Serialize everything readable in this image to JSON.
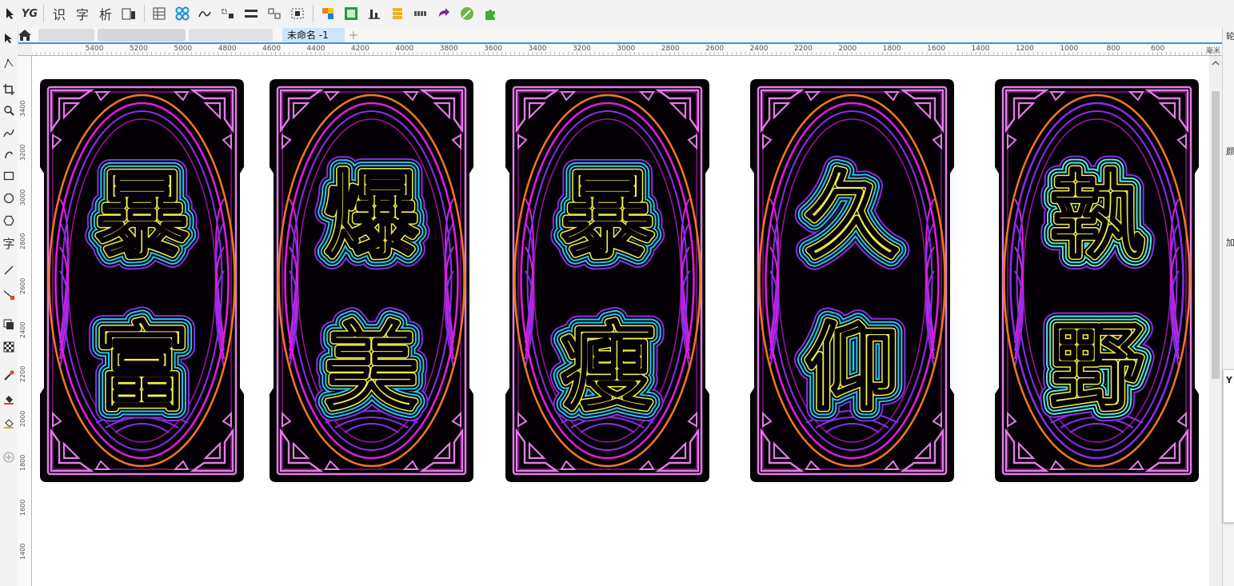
{
  "toolbar": {
    "text_buttons": [
      "YG",
      "识",
      "字",
      "析"
    ],
    "icons": [
      "pointer-tool-icon",
      "properties-icon",
      "table-icon",
      "node-edit-icon",
      "curve-tool-icon",
      "distribute-icon",
      "align-icon",
      "group-icon",
      "break-icon",
      "palette-icon",
      "picture-frame-icon",
      "align-bottom-icon",
      "order-icon",
      "text-grid-icon",
      "redo-style-icon",
      "eyedropper-icon",
      "puzzle-icon"
    ]
  },
  "tabs": {
    "document_tab": "未命名 -1",
    "add_tab": "+"
  },
  "ruler": {
    "unit": "毫米",
    "horizontal_labels": [
      "5400",
      "5200",
      "5000",
      "4800",
      "4600",
      "4400",
      "4200",
      "4000",
      "3800",
      "3600",
      "3400",
      "3200",
      "3000",
      "2800",
      "2600",
      "2400",
      "2200",
      "2000",
      "1800",
      "1600",
      "1400",
      "1200",
      "1000",
      "800",
      "600"
    ],
    "vertical_labels": [
      "3400",
      "3200",
      "3000",
      "2800",
      "2600",
      "2400",
      "2200",
      "2000",
      "1800",
      "1600",
      "1400"
    ]
  },
  "left_tools": {
    "text_tool_label": "字"
  },
  "right_dock": {
    "labels": [
      "轮",
      "颜",
      "加",
      "Y"
    ]
  },
  "cards": [
    {
      "chars": [
        "暴",
        "富"
      ]
    },
    {
      "chars": [
        "爆",
        "美"
      ]
    },
    {
      "chars": [
        "暴",
        "瘦"
      ]
    },
    {
      "chars": [
        "久",
        "仰"
      ]
    },
    {
      "chars": [
        "執",
        "野"
      ]
    }
  ],
  "colors": {
    "card_bg": "#050005",
    "corner_pink": "#e27ce6",
    "magenta": "#e01ee3",
    "purple": "#8a2ee8",
    "orange": "#f07a1a",
    "cyan": "#29c3e9",
    "aqua": "#4ee8e0",
    "yellow_text": "#f2ee47",
    "tab_active": "#cfe5fb",
    "tab_underline": "#3a94dc"
  }
}
